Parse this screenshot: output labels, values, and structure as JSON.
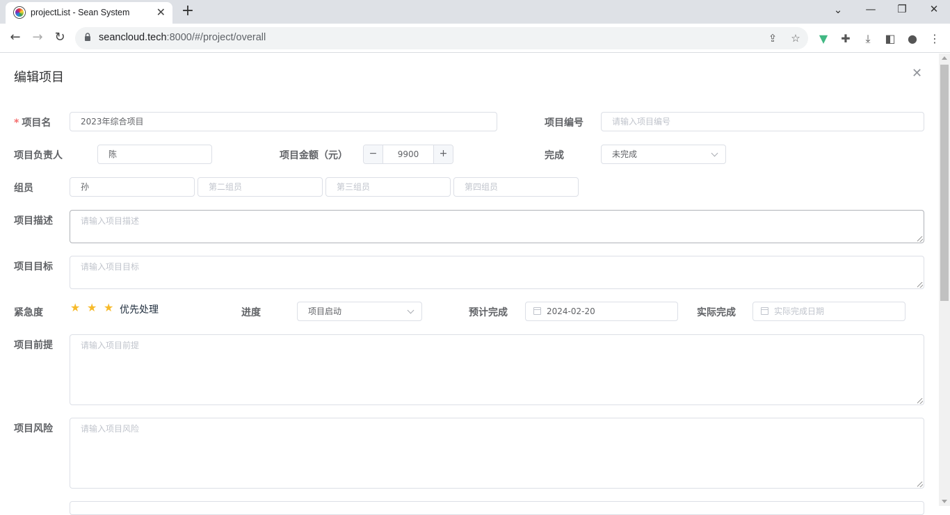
{
  "browser": {
    "tab_title": "projectList - Sean System",
    "url_host": "seancloud.tech",
    "url_rest": ":8000/#/project/overall"
  },
  "dialog": {
    "title": "编辑项目",
    "fields": {
      "name": {
        "label": "项目名",
        "value": "2023年综合项目"
      },
      "code": {
        "label": "项目编号",
        "placeholder": "请输入项目编号"
      },
      "owner": {
        "label": "项目负责人",
        "value": "陈"
      },
      "amount": {
        "label": "项目金额（元）",
        "value": "9900",
        "minus": "−",
        "plus": "+"
      },
      "done": {
        "label": "完成",
        "value": "未完成"
      },
      "members": {
        "label": "组员",
        "values": [
          "孙"
        ],
        "placeholders": [
          "第二组员",
          "第三组员",
          "第四组员"
        ]
      },
      "description": {
        "label": "项目描述",
        "placeholder": "请输入项目描述"
      },
      "goal": {
        "label": "项目目标",
        "placeholder": "请输入项目目标"
      },
      "urgency": {
        "label": "紧急度",
        "stars": 3,
        "text": "优先处理"
      },
      "progress": {
        "label": "进度",
        "value": "项目启动"
      },
      "planned": {
        "label": "预计完成",
        "value": "2024-02-20"
      },
      "actual": {
        "label": "实际完成",
        "placeholder": "实际完成日期"
      },
      "premise": {
        "label": "项目前提",
        "placeholder": "请输入项目前提"
      },
      "risk": {
        "label": "项目风险",
        "placeholder": "请输入项目风险"
      }
    }
  },
  "colors": {
    "required": "#f56c6c",
    "star": "#f7ba2a",
    "border": "#dcdfe6"
  }
}
